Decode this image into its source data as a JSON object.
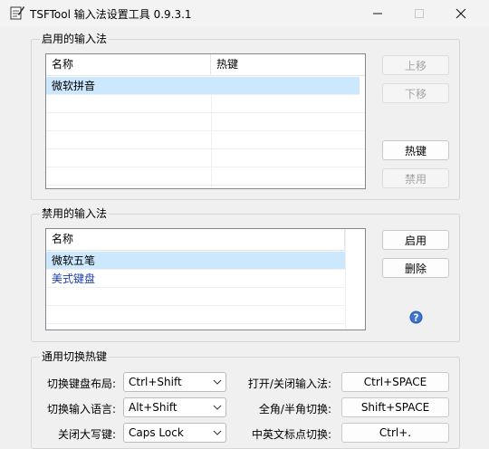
{
  "window": {
    "title": "TSFTool 输入法设置工具 0.9.3.1",
    "minimize": "—",
    "maximize": "☐",
    "close": "✕"
  },
  "enabled_group": {
    "title": "启用的输入法",
    "columns": [
      "名称",
      "热键"
    ],
    "rows": [
      {
        "name": "微软拼音",
        "hotkey": "",
        "selected": true
      }
    ],
    "buttons": {
      "up": "上移",
      "down": "下移",
      "hotkey": "热键",
      "disable": "禁用"
    }
  },
  "disabled_group": {
    "title": "禁用的输入法",
    "columns": [
      "名称"
    ],
    "rows": [
      {
        "name": "微软五笔",
        "selected": true
      },
      {
        "name": "美式键盘",
        "selected": false
      }
    ],
    "buttons": {
      "enable": "启用",
      "delete": "删除"
    },
    "help_icon": "question-circle-icon"
  },
  "hotkeys_group": {
    "title": "通用切换热键",
    "rows": [
      {
        "label": "切换键盘布局:",
        "combo": "Ctrl+Shift",
        "label2": "打开/关闭输入法:",
        "button": "Ctrl+SPACE"
      },
      {
        "label": "切换输入语言:",
        "combo": "Alt+Shift",
        "label2": "全角/半角切换:",
        "button": "Shift+SPACE"
      },
      {
        "label": "关闭大写键:",
        "combo": "Caps Lock",
        "label2": "中英文标点切换:",
        "button": "Ctrl+."
      }
    ]
  }
}
